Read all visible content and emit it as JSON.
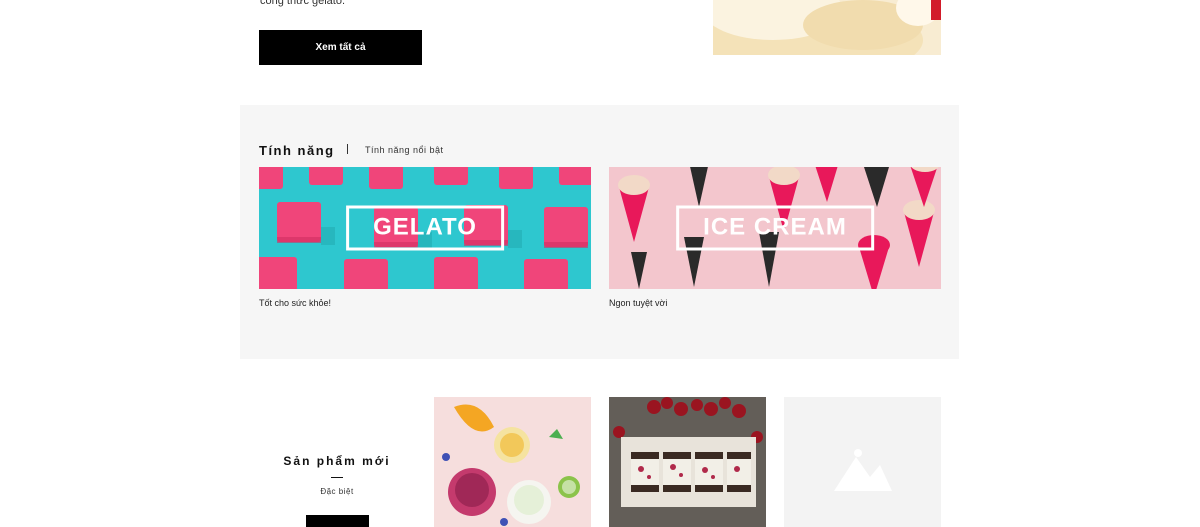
{
  "intro": {
    "text": "công thức gelato.",
    "view_all_label": "Xem tất cả"
  },
  "features": {
    "title": "Tính năng",
    "subtitle": "Tính năng nổi bật",
    "cards": [
      {
        "banner": "GELATO",
        "caption": "Tốt cho sức khỏe!",
        "bg": "#2ec7cf",
        "accent": "#f0457a"
      },
      {
        "banner": "ICE CREAM",
        "caption": "Ngon tuyệt vời",
        "bg": "#f3c6cd",
        "accent": "#e8185a"
      }
    ]
  },
  "new_products": {
    "title": "Sản phẩm mới",
    "subtitle": "Đặc biệt"
  }
}
